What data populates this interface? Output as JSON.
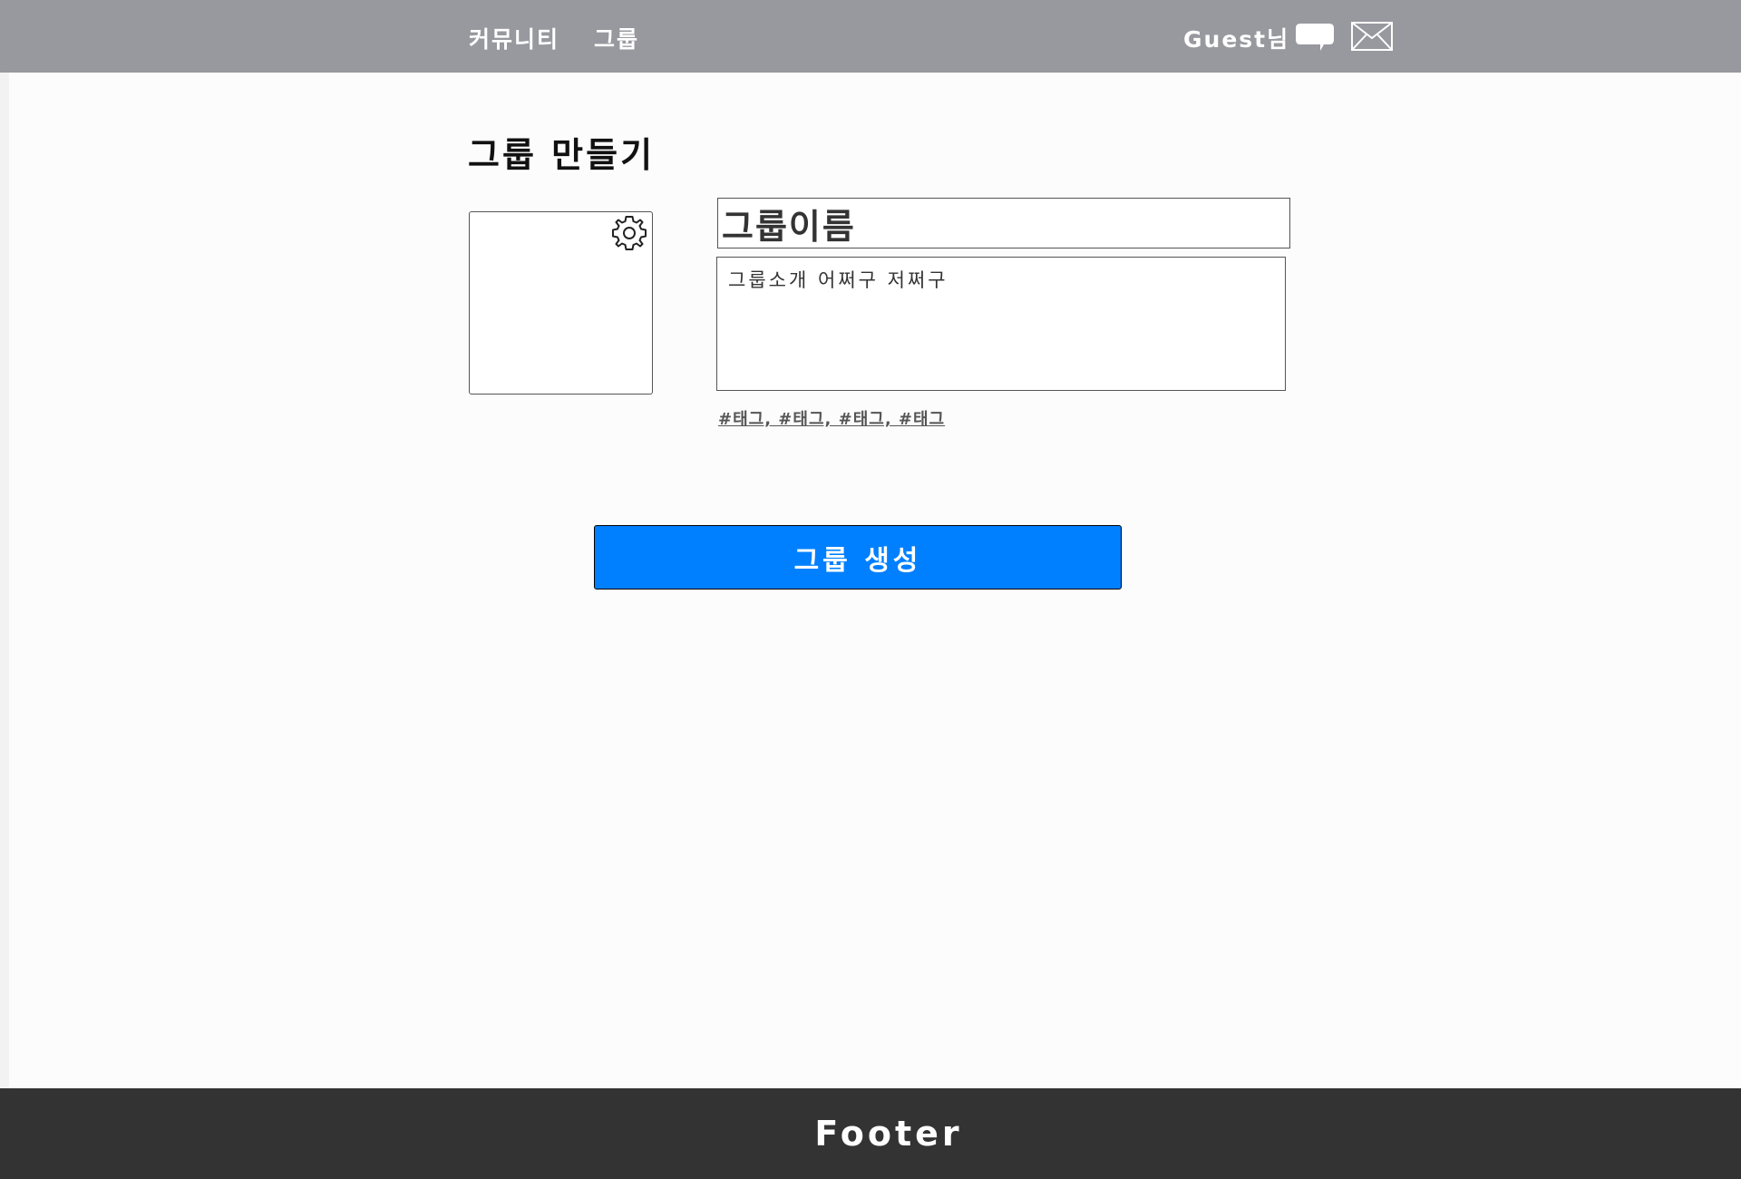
{
  "header": {
    "nav": [
      {
        "label": "커뮤니티"
      },
      {
        "label": "그룹"
      }
    ],
    "user_label": "Guest님",
    "chat_icon": "speech-bubble-icon",
    "mail_icon": "envelope-icon"
  },
  "main": {
    "title": "그룹 만들기",
    "image_settings_icon": "gear-icon",
    "group_name_value": "그룹이름",
    "group_intro_value": "그룹소개 어쩌구 저쩌구",
    "tags_text": "#태그, #태그, #태그, #태그",
    "create_button_label": "그룹 생성"
  },
  "footer": {
    "text": "Footer"
  },
  "colors": {
    "header_bg": "#98989f",
    "accent": "#0080ff",
    "footer_bg": "#333333",
    "page_bg": "#fcfcfc"
  }
}
